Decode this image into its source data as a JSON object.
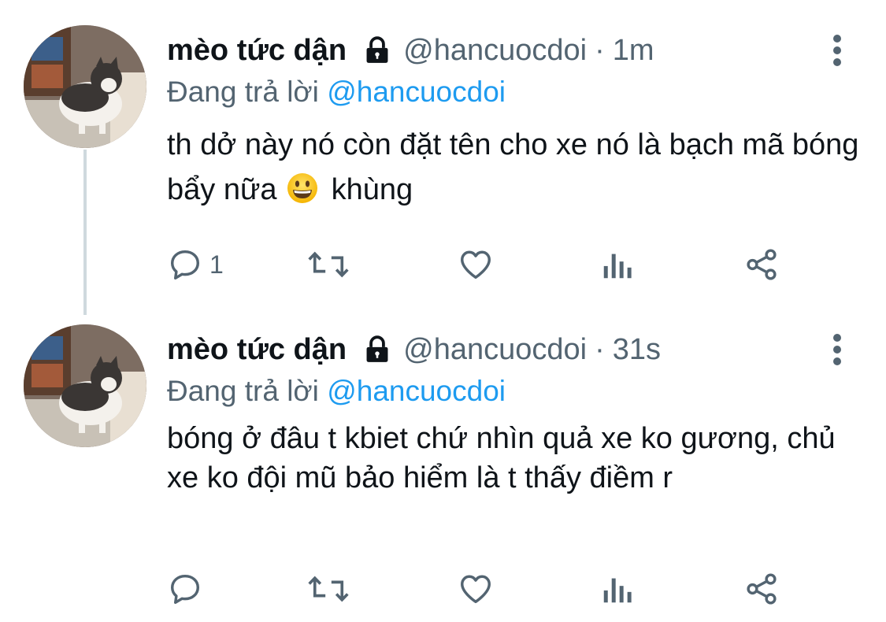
{
  "tweets": [
    {
      "author_name": "mèo tức dận",
      "handle": "@hancuocdoi",
      "separator": "·",
      "time": "1m",
      "replying_prefix": "Đang trả lời",
      "replying_mention": "@hancuocdoi",
      "text_before_emoji": "th dở này nó còn đặt tên cho xe nó là bạch mã bóng bẩy nữa",
      "text_after_emoji": "khùng",
      "emoji": "grinning-face",
      "reply_count": "1"
    },
    {
      "author_name": "mèo tức dận",
      "handle": "@hancuocdoi",
      "separator": "·",
      "time": "31s",
      "replying_prefix": "Đang trả lời",
      "replying_mention": "@hancuocdoi",
      "text": "bóng ở đâu t kbiet chứ nhìn quả xe ko gương, chủ xe ko đội mũ bảo hiểm là t thấy điềm r",
      "reply_count": ""
    }
  ],
  "icons": {
    "lock": "lock-icon",
    "more": "more-vertical-icon",
    "reply": "reply-icon",
    "retweet": "retweet-icon",
    "like": "heart-icon",
    "analytics": "analytics-icon",
    "share": "share-icon"
  },
  "colors": {
    "text": "#0f1419",
    "secondary": "#536471",
    "link": "#1d9bf0",
    "thread_line": "#cfd9de"
  }
}
